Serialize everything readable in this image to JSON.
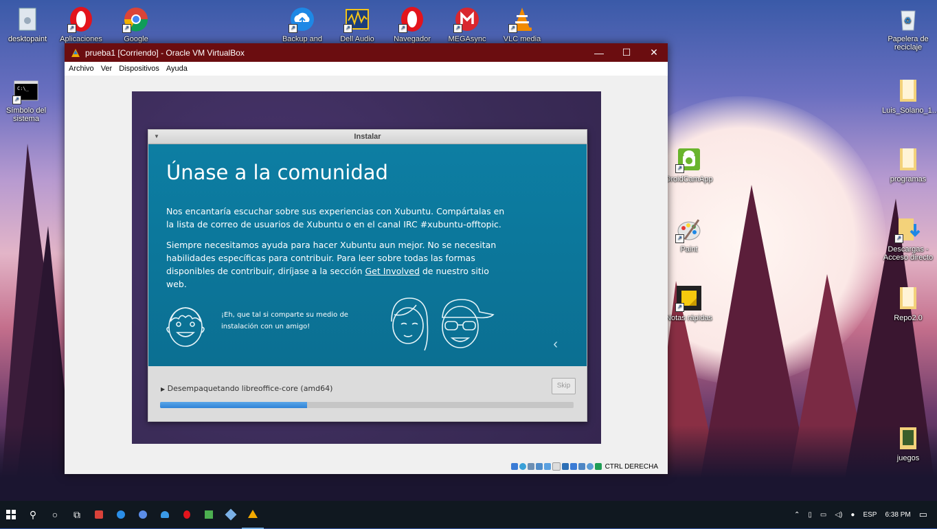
{
  "desktop": {
    "left_icons": [
      {
        "label": "desktopaint",
        "icon": "document-icon"
      },
      {
        "label": "Aplicaciones",
        "icon": "opera-icon"
      },
      {
        "label": "Google Chrome",
        "icon": "chrome-icon"
      },
      {
        "label": "Backup and Sync",
        "icon": "cloud-upload-icon"
      },
      {
        "label": "Dell Audio",
        "icon": "audio-icon"
      },
      {
        "label": "Navegador",
        "icon": "opera-icon"
      },
      {
        "label": "MEGAsync",
        "icon": "mega-icon"
      },
      {
        "label": "VLC media",
        "icon": "vlc-icon"
      },
      {
        "label": "Símbolo del sistema",
        "icon": "terminal-icon"
      }
    ],
    "middle_icons": [
      {
        "label": "DroidCamApp",
        "icon": "android-icon"
      },
      {
        "label": "Paint",
        "icon": "paint-icon"
      },
      {
        "label": "Notas rápidas",
        "icon": "sticky-notes-icon"
      }
    ],
    "right_icons": [
      {
        "label": "Papelera de reciclaje",
        "icon": "recycle-bin-icon"
      },
      {
        "label": "Luis_Solano_1...",
        "icon": "folder-icon"
      },
      {
        "label": "programas",
        "icon": "folder-icon"
      },
      {
        "label": "Descargas - Acceso directo",
        "icon": "downloads-folder-icon"
      },
      {
        "label": "Repo2.0",
        "icon": "folder-icon"
      },
      {
        "label": "juegos",
        "icon": "folder-icon"
      }
    ]
  },
  "vbox": {
    "title": "prueba1 [Corriendo] - Oracle VM VirtualBox",
    "menu": [
      "Archivo",
      "Ver",
      "Dispositivos",
      "Ayuda"
    ],
    "minimize": "—",
    "maximize": "☐",
    "close": "✕",
    "host_key": "CTRL DERECHA"
  },
  "installer": {
    "window_title": "Instalar",
    "heading": "Únase a la comunidad",
    "para1": "Nos encantaría escuchar sobre sus experiencias con Xubuntu. Compártalas en la lista de correo de usuarios de Xubuntu o en el canal IRC #xubuntu-offtopic.",
    "para2_before": "Siempre necesitamos ayuda para hacer Xubuntu aun mejor. No se necesitan habilidades específicas para contribuir. Para leer sobre todas las formas disponibles de contribuir, diríjase a la sección ",
    "para2_link": "Get Involved",
    "para2_after": " de nuestro sitio web.",
    "bubble": "¡Eh, que tal si comparte su medio de instalación con un amigo!",
    "prev_arrow": "‹",
    "status": "Desempaquetando libreoffice-core (amd64)",
    "skip": "Skip",
    "progress_fraction": 0.355
  },
  "taskbar": {
    "lang": "ESP",
    "time": "6:38 PM"
  },
  "colors": {
    "vbox_titlebar": "#6b0d10",
    "slide_bg": "#0d7ea3",
    "progress_fill": "#2f83d6"
  }
}
